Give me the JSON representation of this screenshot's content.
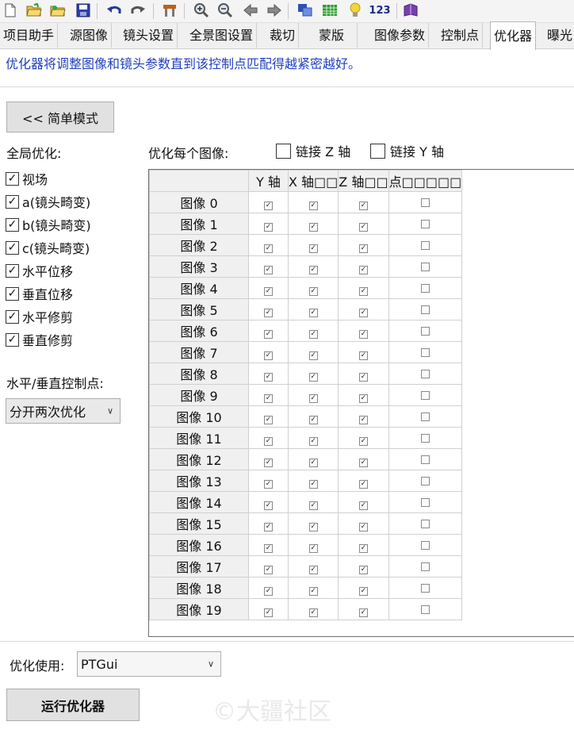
{
  "toolbar": {
    "icons": [
      "new-file-icon",
      "open-folder-icon",
      "open-recent-icon",
      "save-icon",
      "undo-icon",
      "redo-icon",
      "tools-icon",
      "zoom-in-icon",
      "zoom-out-icon",
      "back-arrow-icon",
      "forward-arrow-icon",
      "panorama-editor-icon",
      "table-icon",
      "lightbulb-icon",
      "numbers-icon",
      "book-icon"
    ],
    "numbers_label": "123"
  },
  "tabs": [
    "项目助手",
    "源图像",
    "镜头设置",
    "全景图设置",
    "裁切",
    "蒙版",
    "图像参数",
    "控制点",
    "优化器",
    "曝光"
  ],
  "active_tab": "优化器",
  "description": "优化器将调整图像和镜头参数直到该控制点匹配得越紧密越好。",
  "mode_button": "<< 简单模式",
  "global": {
    "title": "全局优化:",
    "items": [
      {
        "label": "视场",
        "checked": true
      },
      {
        "label": "a(镜头畸变)",
        "checked": true
      },
      {
        "label": "b(镜头畸变)",
        "checked": true
      },
      {
        "label": "c(镜头畸变)",
        "checked": true
      },
      {
        "label": "水平位移",
        "checked": true
      },
      {
        "label": "垂直位移",
        "checked": true
      },
      {
        "label": "水平修剪",
        "checked": true
      },
      {
        "label": "垂直修剪",
        "checked": true
      }
    ]
  },
  "cp": {
    "label": "水平/垂直控制点:",
    "select_value": "分开两次优化"
  },
  "per_image": {
    "title": "优化每个图像:",
    "link_z": {
      "label": "链接 Z 轴",
      "checked": false
    },
    "link_y": {
      "label": "链接 Y 轴",
      "checked": false
    }
  },
  "grid": {
    "columns": [
      "Y 轴",
      "X 轴□□",
      "Z 轴□□",
      "点□□□□□"
    ],
    "rows": [
      {
        "label": "图像 0",
        "values": [
          true,
          true,
          true,
          false
        ]
      },
      {
        "label": "图像 1",
        "values": [
          true,
          true,
          true,
          false
        ]
      },
      {
        "label": "图像 2",
        "values": [
          true,
          true,
          true,
          false
        ]
      },
      {
        "label": "图像 3",
        "values": [
          true,
          true,
          true,
          false
        ]
      },
      {
        "label": "图像 4",
        "values": [
          true,
          true,
          true,
          false
        ]
      },
      {
        "label": "图像 5",
        "values": [
          true,
          true,
          true,
          false
        ]
      },
      {
        "label": "图像 6",
        "values": [
          true,
          true,
          true,
          false
        ]
      },
      {
        "label": "图像 7",
        "values": [
          true,
          true,
          true,
          false
        ]
      },
      {
        "label": "图像 8",
        "values": [
          true,
          true,
          true,
          false
        ]
      },
      {
        "label": "图像 9",
        "values": [
          true,
          true,
          true,
          false
        ]
      },
      {
        "label": "图像 10",
        "values": [
          true,
          true,
          true,
          false
        ]
      },
      {
        "label": "图像 11",
        "values": [
          true,
          true,
          true,
          false
        ]
      },
      {
        "label": "图像 12",
        "values": [
          true,
          true,
          true,
          false
        ]
      },
      {
        "label": "图像 13",
        "values": [
          true,
          true,
          true,
          false
        ]
      },
      {
        "label": "图像 14",
        "values": [
          true,
          true,
          true,
          false
        ]
      },
      {
        "label": "图像 15",
        "values": [
          true,
          true,
          true,
          false
        ]
      },
      {
        "label": "图像 16",
        "values": [
          true,
          true,
          true,
          false
        ]
      },
      {
        "label": "图像 17",
        "values": [
          true,
          true,
          true,
          false
        ]
      },
      {
        "label": "图像 18",
        "values": [
          true,
          true,
          true,
          false
        ]
      },
      {
        "label": "图像 19",
        "values": [
          true,
          true,
          true,
          false
        ]
      }
    ]
  },
  "optimize_with": {
    "label": "优化使用:",
    "value": "PTGui"
  },
  "run_button": "运行优化器",
  "watermark": "©大疆社区"
}
